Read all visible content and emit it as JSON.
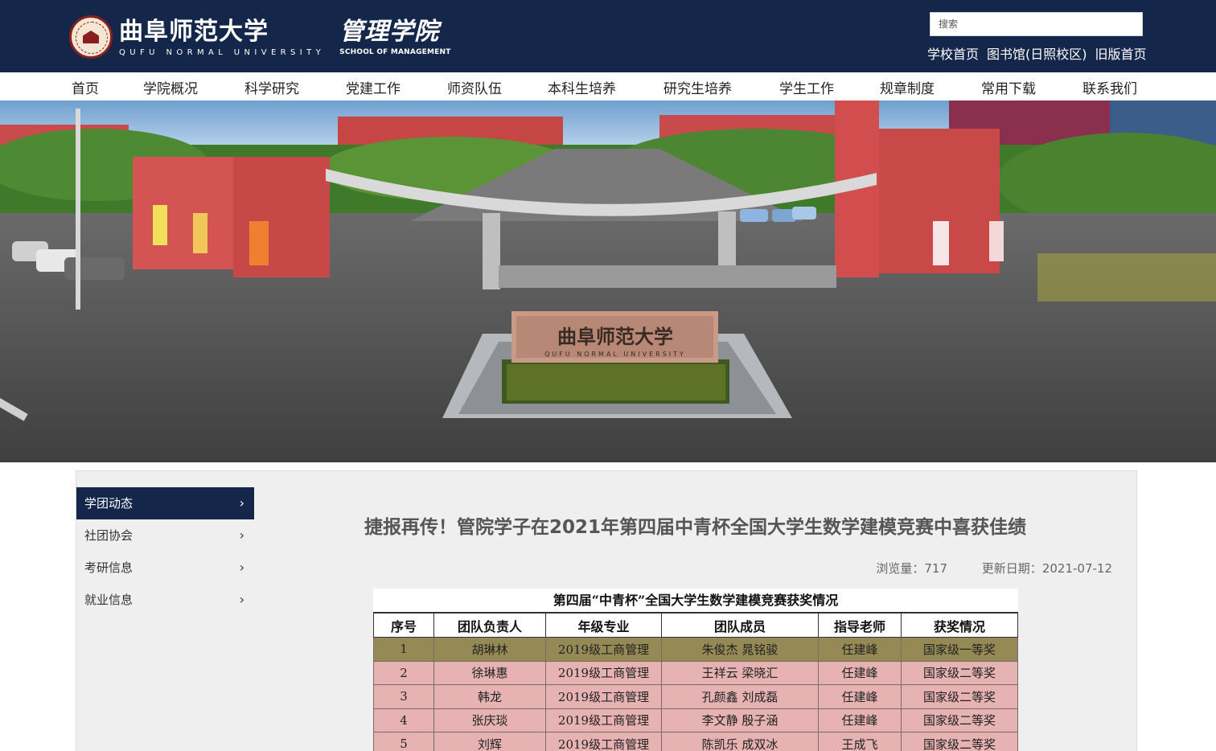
{
  "header": {
    "university_cn": "曲阜师范大学",
    "university_en": "QUFU NORMAL UNIVERSITY",
    "school_cn": "管理学院",
    "school_en": "SCHOOL OF MANAGEMENT",
    "search_placeholder": "搜索",
    "top_links": [
      "学校首页",
      "图书馆(日照校区)",
      "旧版首页"
    ]
  },
  "nav": {
    "items": [
      "首页",
      "学院概况",
      "科学研究",
      "党建工作",
      "师资队伍",
      "本科生培养",
      "研究生培养",
      "学生工作",
      "规章制度",
      "常用下载",
      "联系我们"
    ]
  },
  "banner": {
    "stone_text": "曲阜师范大学",
    "stone_subtext": "QUFU NORMAL UNIVERSITY"
  },
  "sidebar": {
    "items": [
      {
        "label": "学团动态",
        "active": true
      },
      {
        "label": "社团协会",
        "active": false
      },
      {
        "label": "考研信息",
        "active": false
      },
      {
        "label": "就业信息",
        "active": false
      }
    ],
    "chevron": "›"
  },
  "article": {
    "title": "捷报再传！管院学子在2021年第四届中青杯全国大学生数学建模竞赛中喜获佳绩",
    "views_label": "浏览量：",
    "views": "717",
    "date_label": "更新日期：",
    "date": "2021-07-12"
  },
  "award_table": {
    "caption": "第四届“中青杯”全国大学生数学建模竞赛获奖情况",
    "headers": [
      "序号",
      "团队负责人",
      "年级专业",
      "团队成员",
      "指导老师",
      "获奖情况"
    ],
    "rows": [
      [
        "1",
        "胡琳林",
        "2019级工商管理",
        "朱俊杰  晁铭骏",
        "任建峰",
        "国家级一等奖"
      ],
      [
        "2",
        "徐琳惠",
        "2019级工商管理",
        "王祥云  梁晓汇",
        "任建峰",
        "国家级二等奖"
      ],
      [
        "3",
        "韩龙",
        "2019级工商管理",
        "孔颜鑫  刘成磊",
        "任建峰",
        "国家级二等奖"
      ],
      [
        "4",
        "张庆琰",
        "2019级工商管理",
        "李文静  殷子涵",
        "任建峰",
        "国家级二等奖"
      ],
      [
        "5",
        "刘辉",
        "2019级工商管理",
        "陈凯乐  成双冰",
        "王成飞",
        "国家级二等奖"
      ]
    ]
  },
  "colors": {
    "header_bg": "#14264a",
    "first_prize_row": "#958a55",
    "second_prize_row": "#e6b2b2"
  }
}
